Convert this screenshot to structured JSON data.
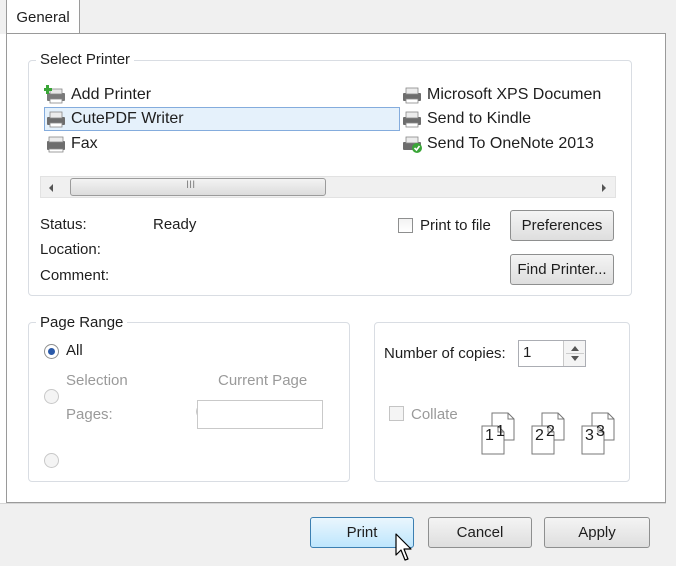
{
  "tab": {
    "general": "General"
  },
  "select_printer": {
    "legend": "Select Printer",
    "printers_left": [
      "Add Printer",
      "CutePDF Writer",
      "Fax"
    ],
    "printers_right": [
      "Microsoft XPS Documen",
      "Send to Kindle",
      "Send To OneNote 2013"
    ],
    "selected": "CutePDF Writer",
    "scroll_grip": "III",
    "status_label": "Status:",
    "status_value": "Ready",
    "location_label": "Location:",
    "comment_label": "Comment:",
    "print_to_file": "Print to file",
    "preferences": "Preferences",
    "find_printer": "Find Printer..."
  },
  "page_range": {
    "legend": "Page Range",
    "all": "All",
    "selection": "Selection",
    "current_page": "Current Page",
    "pages": "Pages:",
    "selected": "All"
  },
  "copies": {
    "label": "Number of copies:",
    "value": "1",
    "collate": "Collate",
    "collate_numbers": [
      "1",
      "1",
      "2",
      "2",
      "3",
      "3"
    ]
  },
  "buttons": {
    "print": "Print",
    "cancel": "Cancel",
    "apply": "Apply"
  },
  "colors": {
    "selection_bg": "#e5f1fb",
    "selection_border": "#84acdd",
    "radio_dot": "#2a59a8",
    "onenote_check": "#3aa537",
    "add_plus": "#3aa537"
  }
}
